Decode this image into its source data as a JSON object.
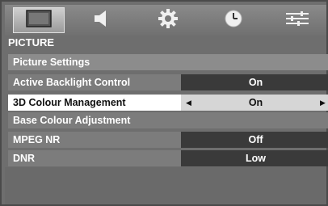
{
  "tabs": [
    {
      "icon": "picture-icon",
      "active": true
    },
    {
      "icon": "speaker-icon",
      "active": false
    },
    {
      "icon": "gear-icon",
      "active": false
    },
    {
      "icon": "clock-icon",
      "active": false
    },
    {
      "icon": "sliders-icon",
      "active": false
    }
  ],
  "menu": {
    "title": "PICTURE",
    "rows": [
      {
        "label": "Picture Settings",
        "value": ""
      },
      {
        "label": "Active Backlight Control",
        "value": "On"
      },
      {
        "label": "3D Colour Management",
        "value": "On"
      },
      {
        "label": "Base Colour Adjustment",
        "value": ""
      },
      {
        "label": "MPEG NR",
        "value": "Off"
      },
      {
        "label": "DNR",
        "value": "Low"
      }
    ]
  },
  "colors": {
    "background": "#6e6e6e",
    "highlight": "#ffffff",
    "value_cell": "#3a3a3a"
  }
}
